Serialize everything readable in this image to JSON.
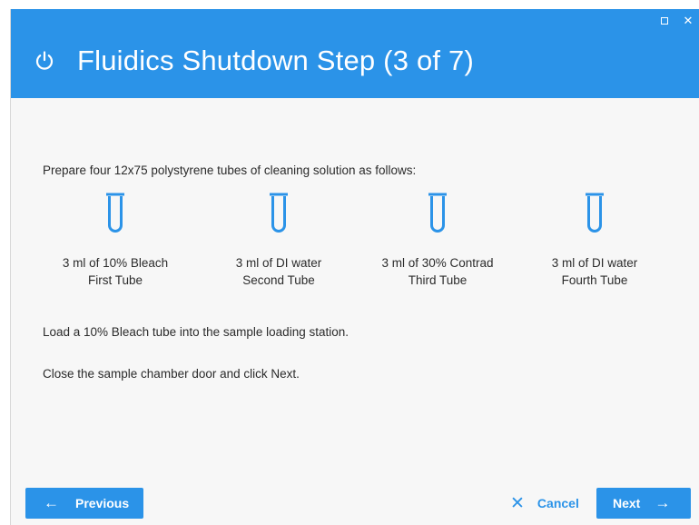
{
  "window": {
    "title": "Fluidics Shutdown Step (3 of 7)",
    "controls": {
      "maximize_icon": "maximize-icon",
      "close_glyph": "✕"
    }
  },
  "content": {
    "intro": "Prepare four 12x75 polystyrene tubes of cleaning solution as follows:",
    "tubes": [
      {
        "line1": "3 ml of 10% Bleach",
        "line2": "First Tube"
      },
      {
        "line1": "3 ml of DI water",
        "line2": "Second Tube"
      },
      {
        "line1": "3 ml of 30% Contrad",
        "line2": "Third Tube"
      },
      {
        "line1": "3 ml of DI water",
        "line2": "Fourth Tube"
      }
    ],
    "load_instruction": "Load a 10% Bleach tube into the sample loading station.",
    "close_instruction": "Close the sample chamber door and click Next."
  },
  "footer": {
    "previous_label": "Previous",
    "cancel_label": "Cancel",
    "next_label": "Next"
  },
  "colors": {
    "accent": "#2b93e8",
    "background": "#f7f7f7",
    "text": "#2b2b2b"
  }
}
